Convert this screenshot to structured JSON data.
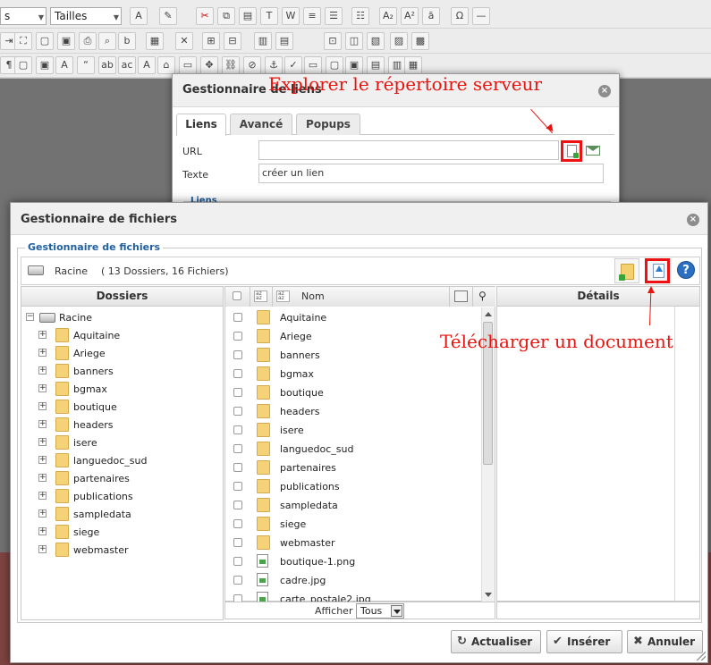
{
  "editor_toolbar": {
    "select_left": "s",
    "select_sizes": "Tailles"
  },
  "links_dialog": {
    "title": "Gestionnaire de liens",
    "tabs": [
      "Liens",
      "Avancé",
      "Popups"
    ],
    "url_label": "URL",
    "url_value": "",
    "text_label": "Texte",
    "text_value": "créer un lien",
    "section_legend": "Liens"
  },
  "annotations": {
    "explore": "Explorer le répertoire serveur",
    "upload": "Télécharger un document",
    "color": "#e8140f"
  },
  "file_manager": {
    "title": "Gestionnaire de fichiers",
    "legend": "Gestionnaire de fichiers",
    "root_label": "Racine",
    "count_label": "( 13 Dossiers, 16 Fichiers)",
    "folders_header": "Dossiers",
    "name_header": "Nom",
    "details_header": "Détails",
    "tree_root": "Racine",
    "folders": [
      "Aquitaine",
      "Ariege",
      "banners",
      "bgmax",
      "boutique",
      "headers",
      "isere",
      "languedoc_sud",
      "partenaires",
      "publications",
      "sampledata",
      "siege",
      "webmaster"
    ],
    "files": [
      "boutique-1.png",
      "cadre.jpg",
      "carte_postale2.jpg"
    ],
    "show_label": "Afficher",
    "show_value": "Tous",
    "buttons": {
      "refresh": "Actualiser",
      "insert": "Insérer",
      "cancel": "Annuler"
    }
  },
  "colors": {
    "accent_blue": "#1f5f9f",
    "highlight_red": "#e11111"
  }
}
